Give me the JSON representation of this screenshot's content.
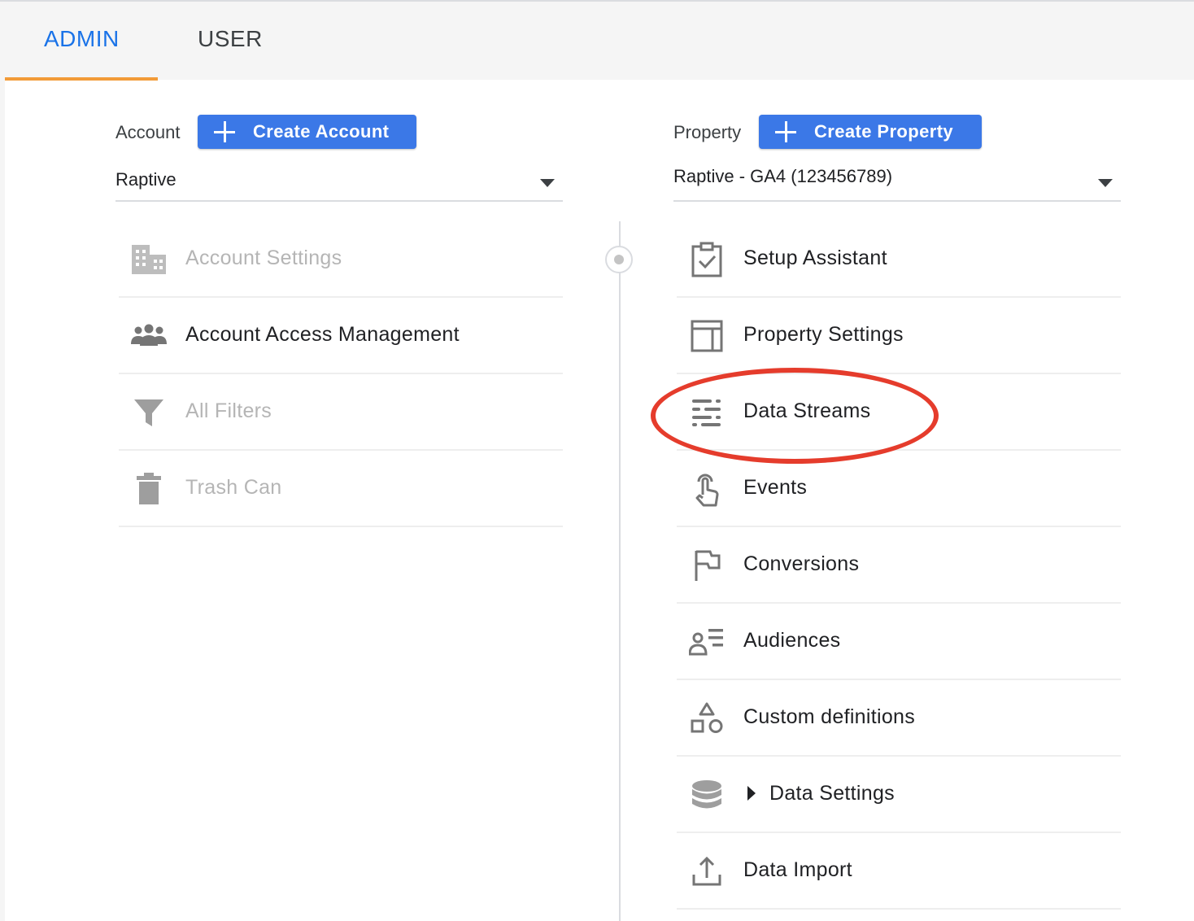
{
  "tabs": {
    "admin": "ADMIN",
    "user": "USER"
  },
  "account": {
    "label": "Account",
    "create_button": "Create Account",
    "selected": "Raptive",
    "items": [
      {
        "label": "Account Settings",
        "icon": "building-icon"
      },
      {
        "label": "Account Access Management",
        "icon": "people-icon"
      },
      {
        "label": "All Filters",
        "icon": "filter-icon"
      },
      {
        "label": "Trash Can",
        "icon": "trash-icon"
      }
    ]
  },
  "property": {
    "label": "Property",
    "create_button": "Create Property",
    "selected": "Raptive - GA4 (123456789)",
    "items": [
      {
        "label": "Setup Assistant",
        "icon": "clipboard-check-icon"
      },
      {
        "label": "Property Settings",
        "icon": "layout-icon"
      },
      {
        "label": "Data Streams",
        "icon": "data-streams-icon"
      },
      {
        "label": "Events",
        "icon": "touch-icon"
      },
      {
        "label": "Conversions",
        "icon": "flag-icon"
      },
      {
        "label": "Audiences",
        "icon": "audience-icon"
      },
      {
        "label": "Custom definitions",
        "icon": "shapes-icon"
      },
      {
        "label": "Data Settings",
        "icon": "database-icon"
      },
      {
        "label": "Data Import",
        "icon": "upload-icon"
      }
    ]
  },
  "colors": {
    "accent_blue": "#1a73e8",
    "button_blue": "#3b78e7",
    "tab_underline": "#f29b38",
    "highlight_red": "#e53c2c"
  }
}
